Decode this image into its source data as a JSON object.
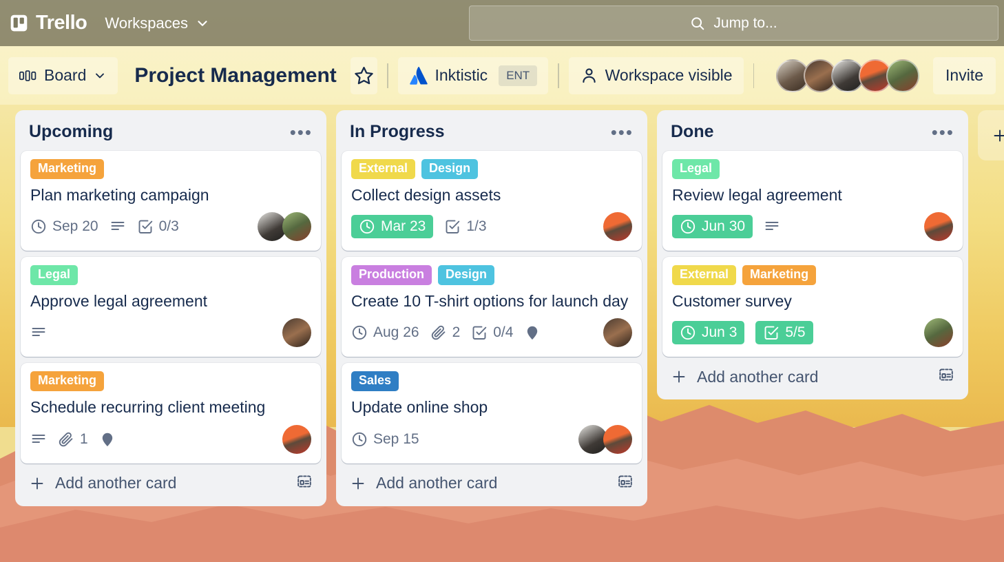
{
  "top_nav": {
    "brand": "Trello",
    "brand_logo_icon": "trello-logo-icon",
    "workspaces_label": "Workspaces",
    "workspaces_chevron_icon": "chevron-down-icon",
    "search": {
      "icon": "search-icon",
      "placeholder": "Jump to...",
      "value": ""
    }
  },
  "board_header": {
    "view_button": {
      "label": "Board",
      "icon": "board-view-icon",
      "chevron_icon": "chevron-down-icon"
    },
    "title": "Project Management",
    "star_icon": "star-icon",
    "workspace": {
      "name": "Inktistic",
      "badge": "ENT",
      "icon": "atlassian-logo-icon"
    },
    "visibility": {
      "label": "Workspace visible",
      "icon": "person-icon"
    },
    "members_count": 5,
    "invite_label": "Invite"
  },
  "colors": {
    "label_marketing": "#f5a33c",
    "label_legal": "#6ee7a8",
    "label_external": "#f0d94b",
    "label_design": "#4ec3e0",
    "label_production": "#c97fe0",
    "label_sales": "#2f7ec4",
    "due_green": "#4bce97",
    "list_background": "#f1f2f4",
    "card_background": "#ffffff",
    "text_primary": "#172b4d",
    "text_muted": "#626f86",
    "sky_top": "#f6eec0",
    "sky_bottom": "#eab94e",
    "canyon": "#e08e6e"
  },
  "add_list": {
    "label": "",
    "icon": "plus-icon"
  },
  "lists": [
    {
      "title": "Upcoming",
      "menu_icon": "ellipsis-icon",
      "add_card": {
        "label": "Add another card",
        "plus_icon": "plus-icon",
        "template_icon": "card-template-icon"
      },
      "cards": [
        {
          "title": "Plan marketing campaign",
          "labels": [
            {
              "text": "Marketing",
              "color": "#f5a33c"
            }
          ],
          "badges": [
            {
              "type": "due",
              "icon": "clock-icon",
              "text": "Sep 20",
              "style": "plain"
            },
            {
              "type": "description",
              "icon": "description-icon",
              "text": ""
            },
            {
              "type": "checklist",
              "icon": "checklist-icon",
              "text": "0/3",
              "style": "plain"
            }
          ],
          "avatars": 2
        },
        {
          "title": "Approve legal agreement",
          "labels": [
            {
              "text": "Legal",
              "color": "#6ee7a8"
            }
          ],
          "badges": [
            {
              "type": "description",
              "icon": "description-icon",
              "text": ""
            }
          ],
          "avatars": 1
        },
        {
          "title": "Schedule recurring client meeting",
          "labels": [
            {
              "text": "Marketing",
              "color": "#f5a33c"
            }
          ],
          "badges": [
            {
              "type": "description",
              "icon": "description-icon",
              "text": ""
            },
            {
              "type": "attachment",
              "icon": "paperclip-icon",
              "text": "1"
            },
            {
              "type": "location",
              "icon": "location-pin-icon",
              "text": ""
            }
          ],
          "avatars": 1
        }
      ]
    },
    {
      "title": "In Progress",
      "menu_icon": "ellipsis-icon",
      "add_card": {
        "label": "Add another card",
        "plus_icon": "plus-icon",
        "template_icon": "card-template-icon"
      },
      "cards": [
        {
          "title": "Collect design assets",
          "labels": [
            {
              "text": "External",
              "color": "#f0d94b"
            },
            {
              "text": "Design",
              "color": "#4ec3e0"
            }
          ],
          "badges": [
            {
              "type": "due",
              "icon": "clock-icon",
              "text": "Mar 23",
              "style": "green"
            },
            {
              "type": "checklist",
              "icon": "checklist-icon",
              "text": "1/3",
              "style": "plain"
            }
          ],
          "avatars": 1
        },
        {
          "title": "Create 10 T-shirt options for launch day",
          "labels": [
            {
              "text": "Production",
              "color": "#c97fe0"
            },
            {
              "text": "Design",
              "color": "#4ec3e0"
            }
          ],
          "badges": [
            {
              "type": "due",
              "icon": "clock-icon",
              "text": "Aug 26",
              "style": "plain"
            },
            {
              "type": "attachment",
              "icon": "paperclip-icon",
              "text": "2"
            },
            {
              "type": "checklist",
              "icon": "checklist-icon",
              "text": "0/4",
              "style": "plain"
            },
            {
              "type": "location",
              "icon": "location-pin-icon",
              "text": ""
            }
          ],
          "avatars": 1
        },
        {
          "title": "Update online shop",
          "labels": [
            {
              "text": "Sales",
              "color": "#2f7ec4"
            }
          ],
          "badges": [
            {
              "type": "due",
              "icon": "clock-icon",
              "text": "Sep 15",
              "style": "plain"
            }
          ],
          "avatars": 2
        }
      ]
    },
    {
      "title": "Done",
      "menu_icon": "ellipsis-icon",
      "add_card": {
        "label": "Add another card",
        "plus_icon": "plus-icon",
        "template_icon": "card-template-icon"
      },
      "cards": [
        {
          "title": "Review legal agreement",
          "labels": [
            {
              "text": "Legal",
              "color": "#6ee7a8"
            }
          ],
          "badges": [
            {
              "type": "due",
              "icon": "clock-icon",
              "text": "Jun 30",
              "style": "green"
            },
            {
              "type": "description",
              "icon": "description-icon",
              "text": ""
            }
          ],
          "avatars": 1
        },
        {
          "title": "Customer survey",
          "labels": [
            {
              "text": "External",
              "color": "#f0d94b"
            },
            {
              "text": "Marketing",
              "color": "#f5a33c"
            }
          ],
          "badges": [
            {
              "type": "due",
              "icon": "clock-icon",
              "text": "Jun 3",
              "style": "green"
            },
            {
              "type": "checklist",
              "icon": "checklist-icon",
              "text": "5/5",
              "style": "green"
            }
          ],
          "avatars": 1
        }
      ]
    }
  ]
}
